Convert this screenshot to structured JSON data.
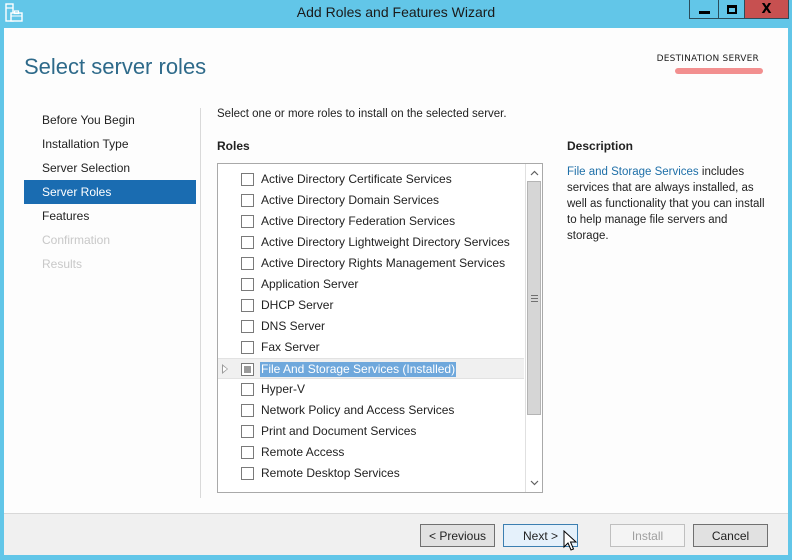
{
  "window": {
    "title": "Add Roles and Features Wizard",
    "controls": {
      "minimize": "minimize",
      "maximize": "maximize",
      "close": "X"
    }
  },
  "header": {
    "page_title": "Select server roles",
    "destination_label": "DESTINATION SERVER",
    "destination_value_redacted": true
  },
  "nav": {
    "items": [
      {
        "label": "Before You Begin",
        "state": "normal"
      },
      {
        "label": "Installation Type",
        "state": "normal"
      },
      {
        "label": "Server Selection",
        "state": "normal"
      },
      {
        "label": "Server Roles",
        "state": "active"
      },
      {
        "label": "Features",
        "state": "normal"
      },
      {
        "label": "Confirmation",
        "state": "disabled"
      },
      {
        "label": "Results",
        "state": "disabled"
      }
    ]
  },
  "main": {
    "instructions": "Select one or more roles to install on the selected server.",
    "roles_heading": "Roles",
    "roles": [
      {
        "label": "Active Directory Certificate Services",
        "checked": false
      },
      {
        "label": "Active Directory Domain Services",
        "checked": false
      },
      {
        "label": "Active Directory Federation Services",
        "checked": false
      },
      {
        "label": "Active Directory Lightweight Directory Services",
        "checked": false
      },
      {
        "label": "Active Directory Rights Management Services",
        "checked": false
      },
      {
        "label": "Application Server",
        "checked": false
      },
      {
        "label": "DHCP Server",
        "checked": false
      },
      {
        "label": "DNS Server",
        "checked": false
      },
      {
        "label": "Fax Server",
        "checked": false
      },
      {
        "label": "File And Storage Services (Installed)",
        "checked": "indeterminate",
        "expandable": true,
        "selected": true
      },
      {
        "label": "Hyper-V",
        "checked": false
      },
      {
        "label": "Network Policy and Access Services",
        "checked": false
      },
      {
        "label": "Print and Document Services",
        "checked": false
      },
      {
        "label": "Remote Access",
        "checked": false
      },
      {
        "label": "Remote Desktop Services",
        "checked": false
      }
    ],
    "scrollbar": {
      "up": "^",
      "down": "v"
    }
  },
  "description": {
    "heading": "Description",
    "link": "File and Storage Services",
    "text": " includes services that are always installed, as well as functionality that you can install to help manage file servers and storage."
  },
  "footer": {
    "previous": "< Previous",
    "next": "Next >",
    "install": "Install",
    "cancel": "Cancel"
  }
}
